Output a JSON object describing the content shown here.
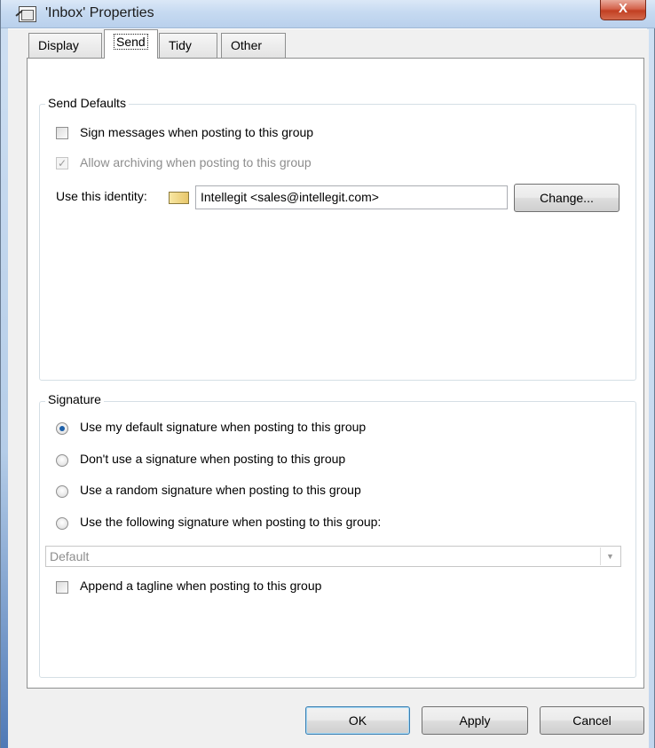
{
  "window": {
    "title": "'Inbox' Properties",
    "close_label": "X"
  },
  "tabs": [
    {
      "label": "Display"
    },
    {
      "label": "Send"
    },
    {
      "label": "Tidy"
    },
    {
      "label": "Other"
    }
  ],
  "send_defaults": {
    "group_label": "Send Defaults",
    "sign_messages": {
      "label": "Sign messages when posting to this group",
      "checked": false
    },
    "allow_archiving": {
      "label": "Allow archiving when posting to this group",
      "checked": true,
      "disabled": true
    },
    "identity_label": "Use this identity:",
    "identity_value": "Intellegit <sales@intellegit.com>",
    "change_button": "Change..."
  },
  "signature": {
    "group_label": "Signature",
    "options": [
      {
        "label": "Use my default signature when posting to this group",
        "selected": true
      },
      {
        "label": "Don't use a signature when posting to this group",
        "selected": false
      },
      {
        "label": "Use a random signature when posting to this group",
        "selected": false
      },
      {
        "label": "Use the following signature when posting to this group:",
        "selected": false
      }
    ],
    "dropdown_value": "Default",
    "append_tagline": {
      "label": "Append a tagline when posting to this group",
      "checked": false
    }
  },
  "footer": {
    "ok": "OK",
    "apply": "Apply",
    "cancel": "Cancel"
  }
}
